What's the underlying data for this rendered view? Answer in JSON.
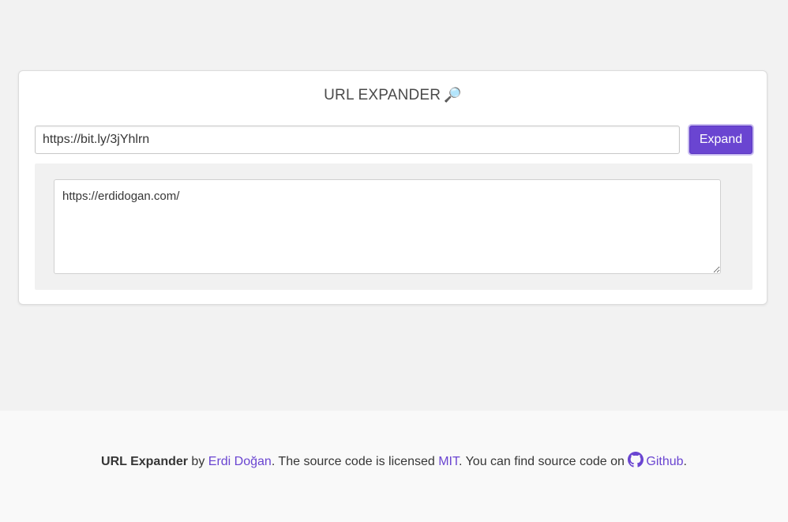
{
  "app": {
    "title": "URL EXPANDER",
    "title_icon": "magnifier-emoji"
  },
  "form": {
    "url_value": "https://bit.ly/3jYhlrn",
    "expand_label": "Expand"
  },
  "result": {
    "expanded_url": "https://erdidogan.com/"
  },
  "footer": {
    "app_name": "URL Expander",
    "by_text": " by ",
    "author": "Erdi Doğan",
    "license_text": ". The source code is licensed ",
    "license": "MIT",
    "source_text": ". You can find source code on ",
    "github_label": "Github",
    "end_text": ".",
    "github_icon": "github-icon"
  },
  "colors": {
    "accent": "#6a45d1",
    "background": "#f2f2f2",
    "footer_background": "#f9f9f9"
  }
}
